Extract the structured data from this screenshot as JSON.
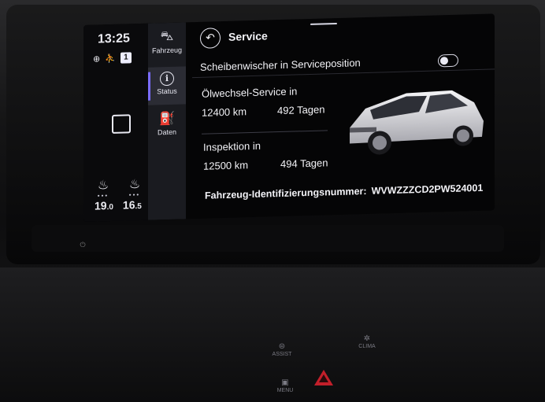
{
  "status": {
    "clock": "13:25",
    "profile_badge": "1",
    "seat_left_temp_main": "19",
    "seat_left_temp_dec": ".0",
    "seat_right_temp_main": "16",
    "seat_right_temp_dec": ".5"
  },
  "tabs": [
    {
      "label": "Fahrzeug",
      "icon": "car-icon"
    },
    {
      "label": "Status",
      "icon": "info-icon"
    },
    {
      "label": "Daten",
      "icon": "fuel-data-icon"
    }
  ],
  "header": {
    "title": "Service"
  },
  "wiper": {
    "label": "Scheibenwischer in Serviceposition",
    "enabled": false
  },
  "oil_service": {
    "title": "Ölwechsel-Service in",
    "km": "12400 km",
    "days": "492 Tagen"
  },
  "inspection": {
    "title": "Inspektion in",
    "km": "12500 km",
    "days": "494 Tagen"
  },
  "vin": {
    "label": "Fahrzeug-Identifizierungsnummer:",
    "value": "WVWZZZCD2PW524001"
  },
  "console": {
    "assist_label": "ASSIST",
    "clima_label": "CLIMA",
    "menu_label": "MENU"
  },
  "colors": {
    "accent": "#7a6cff",
    "hazard": "#c21f2a"
  }
}
